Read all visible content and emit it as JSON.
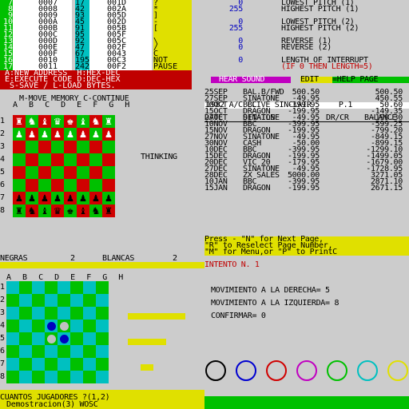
{
  "monitor": {
    "rows": [
      {
        "ln": "7",
        "a": "0007",
        "b": "17",
        "c": "001D",
        "d": "?"
      },
      {
        "ln": "8",
        "a": "0008",
        "b": "42",
        "c": "002A",
        "d": "*"
      },
      {
        "ln": "9",
        "a": "0009",
        "b": "93",
        "c": "005D",
        "d": "]"
      },
      {
        "ln": "10",
        "a": "000A",
        "b": "45",
        "c": "002D",
        "d": "-"
      },
      {
        "ln": "11",
        "a": "000B",
        "b": "91",
        "c": "005B",
        "d": "["
      },
      {
        "ln": "12",
        "a": "000C",
        "b": "95",
        "c": "005F",
        "d": "_"
      },
      {
        "ln": "13",
        "a": "000D",
        "b": "92",
        "c": "005C",
        "d": "\\"
      },
      {
        "ln": "14",
        "a": "000E",
        "b": "47",
        "c": "002F",
        "d": "/"
      },
      {
        "ln": "15",
        "a": "000F",
        "b": "67",
        "c": "0043",
        "d": "C"
      },
      {
        "ln": "16",
        "a": "0010",
        "b": "195",
        "c": "00C3",
        "d": "NOT"
      },
      {
        "ln": "17",
        "a": "0011",
        "b": "242",
        "c": "00F2",
        "d": "PAUSE"
      }
    ],
    "menu": [
      " A:NEW ADDRESS  H:HEX-DEC",
      " E:EXECUTE CODE D:DEC-HEX",
      "  S-SAVE / L-LOAD BYTES."
    ]
  },
  "sound": {
    "rows": [
      {
        "v": "0",
        "l": "LOWEST PITCH (1)"
      },
      {
        "v": "255",
        "l": "HIGHEST PITCH (1)"
      },
      {
        "v": "0",
        "l": "LOWEST PITCH (2)"
      },
      {
        "v": "255",
        "l": "HIGHEST PITCH (2)"
      },
      {
        "v": "0",
        "l": "REVERSE (1)"
      },
      {
        "v": "0",
        "l": "REVERSE (2)"
      },
      {
        "v": "0",
        "l": "LENGTH OF INTERRUPT"
      }
    ],
    "note": "(IF 0 THEN LENGTH=5)",
    "hear": "HEAR SOUND",
    "edit": "EDIT",
    "help": "=HELP PAGE"
  },
  "chess": {
    "header": "M-MOVE MEMORY C-CONTINUE",
    "files": "A B C D E F G H",
    "ranks": [
      "1",
      "2",
      "3",
      "4",
      "5",
      "6",
      "7",
      "8"
    ],
    "status": "THINKING",
    "pieces_top": [
      "♜",
      "♞",
      "♝",
      "♛",
      "♚",
      "♝",
      "♞",
      "♜"
    ],
    "pieces_pawn": "♟",
    "pieces_bot": [
      "♜",
      "♞",
      "♝",
      "♛",
      "♚",
      "♝",
      "♞",
      "♜"
    ]
  },
  "ledger": {
    "title": "1982 A/C CLIVE SINCLAIR      P.1",
    "headers": {
      "date": "DATE",
      "details": "DETAILS",
      "drcr": "DR/CR",
      "bal": "BALANCE"
    },
    "rows": [
      {
        "date": "25SEP",
        "details": "BAL.B/FWD",
        "drcr": "500.50",
        "bal": "500.50"
      },
      {
        "date": "27SEP",
        "details": "SINATONE",
        "drcr": "-49.95",
        "bal": "450.55"
      },
      {
        "date": "10OCT",
        "details": "BBC",
        "drcr": "-399.95",
        "bal": "50.60"
      },
      {
        "date": "15OCT",
        "details": "DRAGON",
        "drcr": "-199.95",
        "bal": "-149.35"
      },
      {
        "date": "27OCT",
        "details": "SINATONE",
        "drcr": "-49.95",
        "bal": "-199.30"
      },
      {
        "date": "10NOV",
        "details": "BBC",
        "drcr": "-399.95",
        "bal": "-599.25"
      },
      {
        "date": "15NOV",
        "details": "DRAGON",
        "drcr": "-199.95",
        "bal": "-799.20"
      },
      {
        "date": "27NOV",
        "details": "SINATONE",
        "drcr": "-49.95",
        "bal": "-849.15"
      },
      {
        "date": "30NOV",
        "details": "CASH",
        "drcr": "-50.00",
        "bal": "-899.15"
      },
      {
        "date": "10DEC",
        "details": "BBC",
        "drcr": "-399.95",
        "bal": "-1299.10"
      },
      {
        "date": "15DEC",
        "details": "DRAGON",
        "drcr": "-199.95",
        "bal": "-1499.05"
      },
      {
        "date": "20DEC",
        "details": "VIC 20",
        "drcr": "-179.95",
        "bal": "-1679.00"
      },
      {
        "date": "27DEC",
        "details": "SINATONE",
        "drcr": "-49.95",
        "bal": "-1728.95"
      },
      {
        "date": "28DEC",
        "details": "ZX SALES",
        "drcr": "5000.00",
        "bal": "3271.05"
      },
      {
        "date": "10JAN",
        "details": "BBC",
        "drcr": "-399.95",
        "bal": "2871.10"
      },
      {
        "date": "15JAN",
        "details": "DRAGON",
        "drcr": "-199.95",
        "bal": "2671.15"
      }
    ],
    "press": [
      "Press - \"N\" for Next Page,",
      "\"R\" to Reselect Page Number,",
      "\"M\" for Menu,or \"P\" to PrintC"
    ]
  },
  "reversi": {
    "negras_label": "NEGRAS",
    "negras_val": "2",
    "blancas_label": "BLANCAS",
    "blancas_val": "2",
    "files": "A B C D E F G H",
    "ranks": [
      "1",
      "2",
      "3",
      "4",
      "5",
      "6",
      "7",
      "8"
    ],
    "players_prompt": "CUANTOS JUGADORES ?(1,2)",
    "demo": "Demostracion(3) WOSC"
  },
  "mastermind": {
    "intento": "INTENTO N. 1",
    "right": "MOVIMIENTO A LA DERECHA= 5",
    "left": "MOVIMIENTO A LA IZQUIERDA= 8",
    "confirm": "CONFIRMAR= 0",
    "ring_colors": [
      "#000000",
      "#0000d0",
      "#d00000",
      "#c000c0",
      "#00c000",
      "#00c0c0",
      "#e0e000"
    ]
  },
  "colors": {
    "yellow": "#e0e000",
    "green": "#00c000",
    "red": "#c00000",
    "cyan": "#00c0c0",
    "magenta": "#c000c0",
    "blue": "#0000c0"
  }
}
